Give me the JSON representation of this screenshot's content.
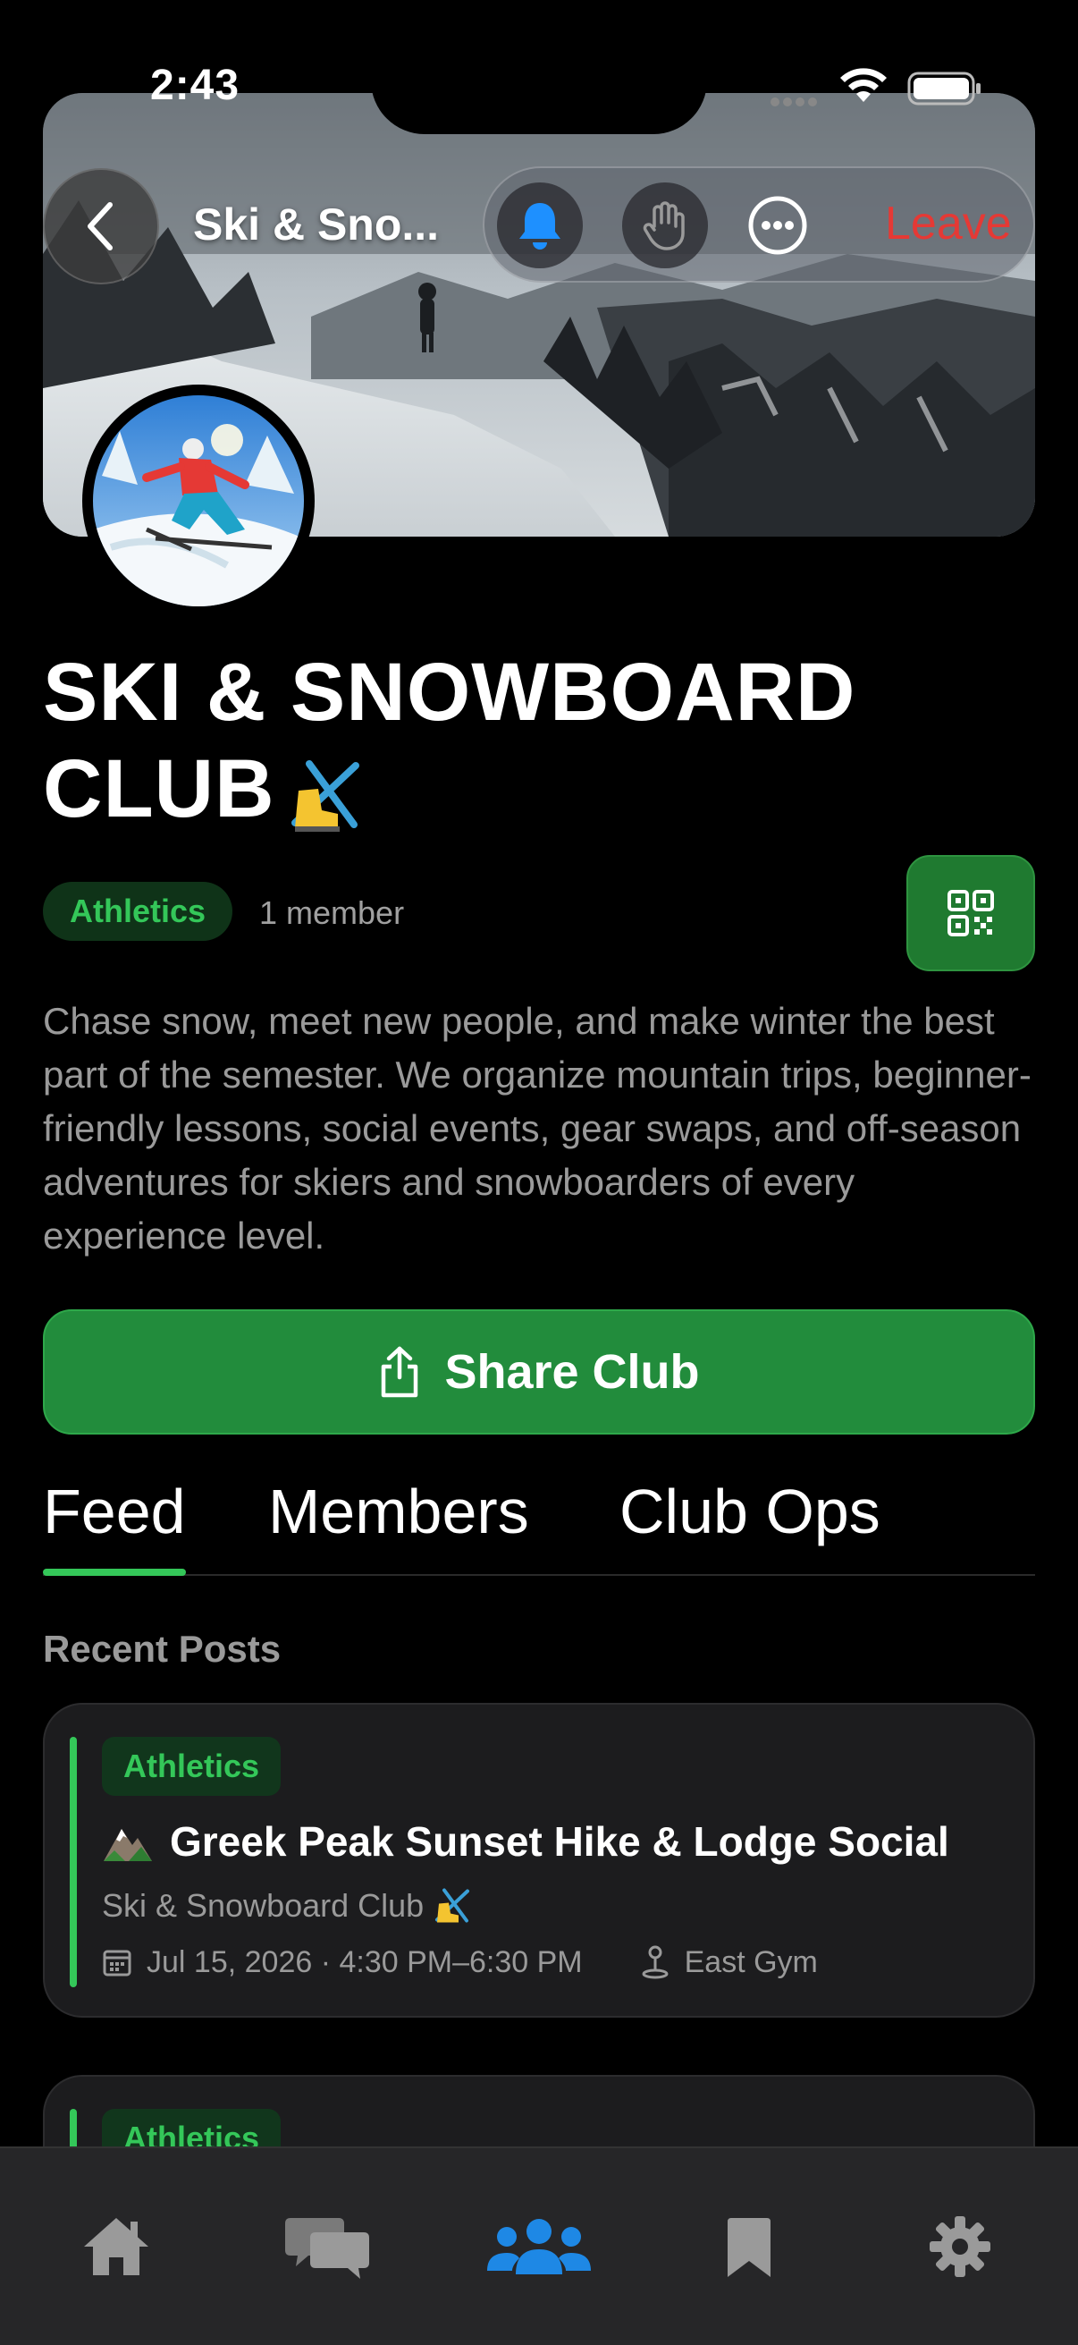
{
  "status_bar": {
    "time": "2:43"
  },
  "nav": {
    "title": "Ski & Sno...",
    "leave_label": "Leave"
  },
  "club": {
    "title": "SKI & SNOWBOARD CLUB",
    "category": "Athletics",
    "member_count": "1 member",
    "description": "Chase snow, meet new people, and make winter the best part of the semester. We organize mountain trips, beginner-friendly lessons, social events, gear swaps, and off-season adventures for skiers and snowboarders of every experience level.",
    "share_label": "Share Club"
  },
  "tabs": [
    {
      "label": "Feed",
      "selected": true
    },
    {
      "label": "Members",
      "selected": false
    },
    {
      "label": "Club Ops",
      "selected": false
    }
  ],
  "feed": {
    "heading": "Recent Posts",
    "posts": [
      {
        "category": "Athletics",
        "title": "Greek Peak Sunset Hike & Lodge Social",
        "club": "Ski & Snowboard Club",
        "datetime": "Jul 15, 2026 · 4:30 PM–6:30 PM",
        "location": "East Gym"
      },
      {
        "category": "Athletics"
      }
    ]
  },
  "tab_bar": {
    "items": [
      {
        "icon": "home-icon",
        "active": false
      },
      {
        "icon": "chat-bubbles-icon",
        "active": false
      },
      {
        "icon": "groups-icon",
        "active": true
      },
      {
        "icon": "bookmark-icon",
        "active": false
      },
      {
        "icon": "settings-gear-icon",
        "active": false
      }
    ]
  },
  "colors": {
    "accent_green": "#34c759",
    "share_button": "#228c3c",
    "leave_red": "#e53935",
    "active_tab_blue": "#1e88e5",
    "bell_blue": "#1e90ff"
  }
}
